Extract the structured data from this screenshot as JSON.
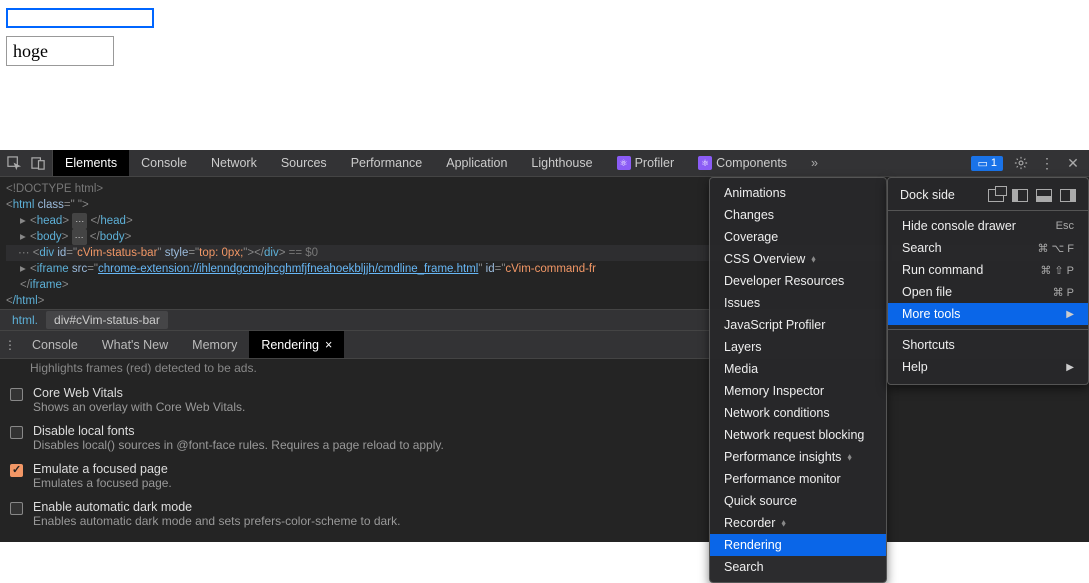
{
  "page": {
    "input1_value": "",
    "input2_value": "hoge"
  },
  "tabs": {
    "elements": "Elements",
    "console": "Console",
    "network": "Network",
    "sources": "Sources",
    "performance": "Performance",
    "application": "Application",
    "lighthouse": "Lighthouse",
    "profiler": "Profiler",
    "components": "Components"
  },
  "warn_count": "1",
  "elements": {
    "doctype": "<!DOCTYPE html>",
    "html_open_pre": "<",
    "html_tag": "html",
    "class_attr": " class",
    "eq": "=\"",
    "class_val": "   ",
    "close_q": "\">",
    "head_tag": "head",
    "body_tag": "body",
    "div_tag": "div",
    "id_attr": " id",
    "status_id": "cVim-status-bar",
    "style_attr": " style",
    "style_val": "top: 0px;",
    "sel_eq": " == $0",
    "iframe_tag": "iframe",
    "src_attr": " src",
    "iframe_src": "chrome-extension://ihlenndgcmojhcghmfjfneahoekbljjh/cmdline_frame.html",
    "iframe_id": "cVim-command-fr",
    "iframe_close": "iframe",
    "html_close": "/html"
  },
  "breadcrumb": {
    "html": "html.",
    "sel": "div#cVim-status-bar"
  },
  "drawer_tabs": {
    "console": "Console",
    "whatsnew": "What's New",
    "memory": "Memory",
    "rendering": "Rendering"
  },
  "drawer": {
    "cut_line": "Highlights frames (red) detected to be ads.",
    "opt1_title": "Core Web Vitals",
    "opt1_desc": "Shows an overlay with Core Web Vitals.",
    "opt2_title": "Disable local fonts",
    "opt2_desc": "Disables local() sources in @font-face rules. Requires a page reload to apply.",
    "opt3_title": "Emulate a focused page",
    "opt3_desc": "Emulates a focused page.",
    "opt4_title": "Enable automatic dark mode",
    "opt4_desc": "Enables automatic dark mode and sets prefers-color-scheme to dark."
  },
  "submenu": {
    "items": [
      "Animations",
      "Changes",
      "Coverage",
      "CSS Overview",
      "Developer Resources",
      "Issues",
      "JavaScript Profiler",
      "Layers",
      "Media",
      "Memory Inspector",
      "Network conditions",
      "Network request blocking",
      "Performance insights",
      "Performance monitor",
      "Quick source",
      "Recorder",
      "Rendering",
      "Search"
    ],
    "selected": "Rendering",
    "experimental": [
      "CSS Overview",
      "Performance insights",
      "Recorder"
    ]
  },
  "mainmenu": {
    "dock_label": "Dock side",
    "hide_drawer": "Hide console drawer",
    "hide_drawer_sc": "Esc",
    "search": "Search",
    "search_sc": "⌘ ⌥ F",
    "run": "Run command",
    "run_sc": "⌘ ⇧ P",
    "open": "Open file",
    "open_sc": "⌘ P",
    "more_tools": "More tools",
    "shortcuts": "Shortcuts",
    "help": "Help"
  }
}
